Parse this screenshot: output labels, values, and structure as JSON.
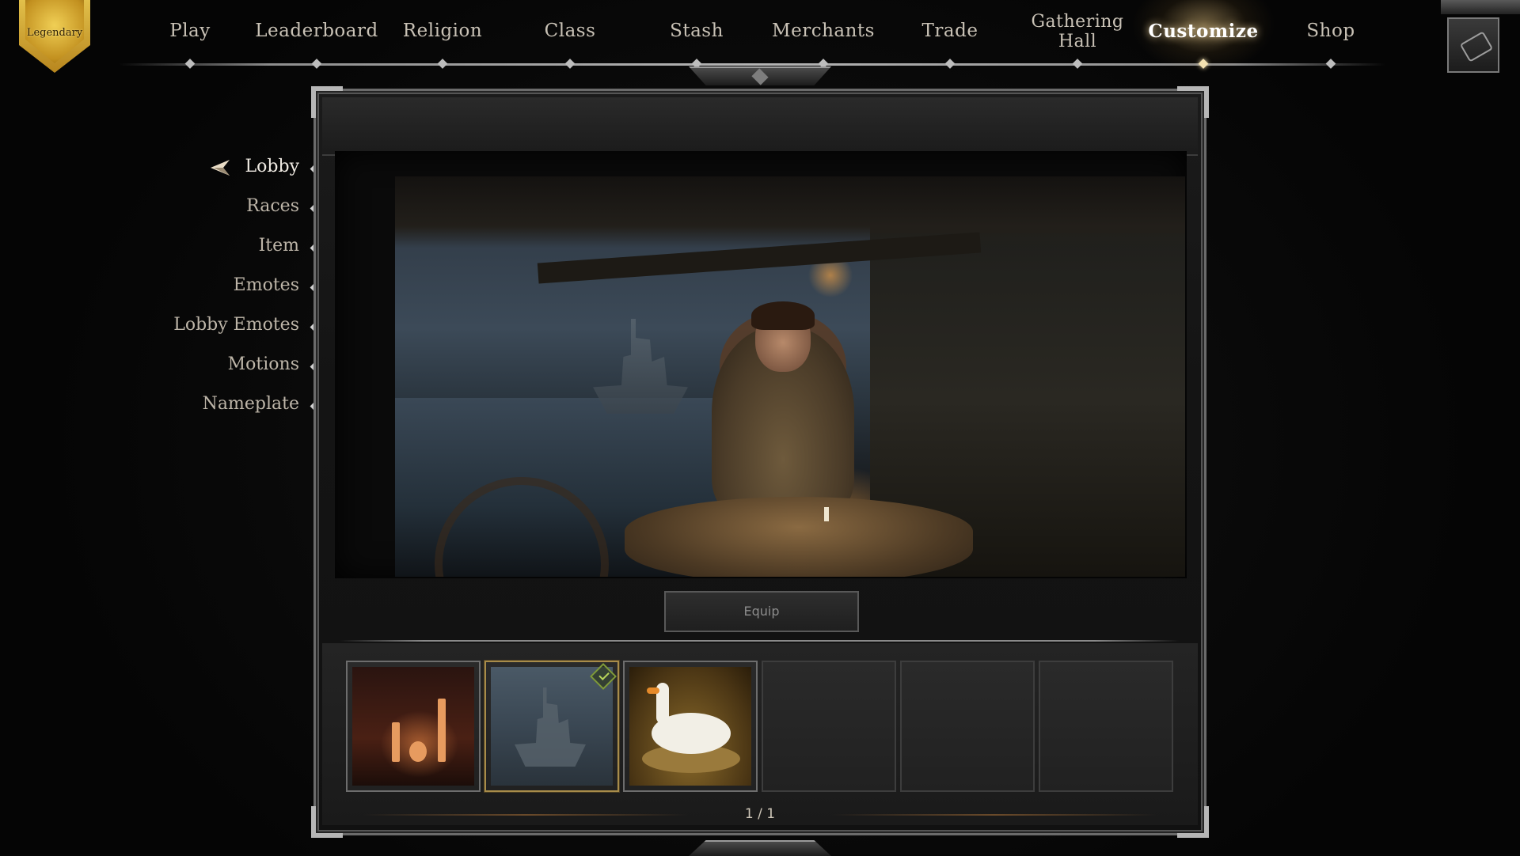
{
  "rank": {
    "label": "Legendary",
    "color": "#d4a62f"
  },
  "nav": {
    "items": [
      {
        "id": "play",
        "label": "Play"
      },
      {
        "id": "leaderboard",
        "label": "Leaderboard"
      },
      {
        "id": "religion",
        "label": "Religion"
      },
      {
        "id": "class",
        "label": "Class"
      },
      {
        "id": "stash",
        "label": "Stash"
      },
      {
        "id": "merchants",
        "label": "Merchants"
      },
      {
        "id": "trade",
        "label": "Trade"
      },
      {
        "id": "gathering_hall",
        "label": "Gathering Hall"
      },
      {
        "id": "customize",
        "label": "Customize"
      },
      {
        "id": "shop",
        "label": "Shop"
      }
    ],
    "active": "Customize",
    "utility_icon": "flashlight-icon"
  },
  "side_menu": {
    "items": [
      {
        "label": "Lobby"
      },
      {
        "label": "Races"
      },
      {
        "label": "Item"
      },
      {
        "label": "Emotes"
      },
      {
        "label": "Lobby Emotes"
      },
      {
        "label": "Motions"
      },
      {
        "label": "Nameplate"
      }
    ],
    "active": "Lobby",
    "active_icon": "arrow-pointer-icon"
  },
  "preview": {
    "equip_label": "Equip"
  },
  "slots": [
    {
      "state": "filled",
      "art": "candles"
    },
    {
      "state": "filled",
      "art": "ghost-ship",
      "equipped": true
    },
    {
      "state": "filled",
      "art": "goose"
    },
    {
      "state": "empty"
    },
    {
      "state": "empty"
    },
    {
      "state": "empty"
    }
  ],
  "pager": {
    "text": "1 / 1"
  },
  "colors": {
    "accent_gold": "#f2d8a0",
    "equipped_green": "#b7d45a",
    "frame_border": "#6b6b6b"
  }
}
